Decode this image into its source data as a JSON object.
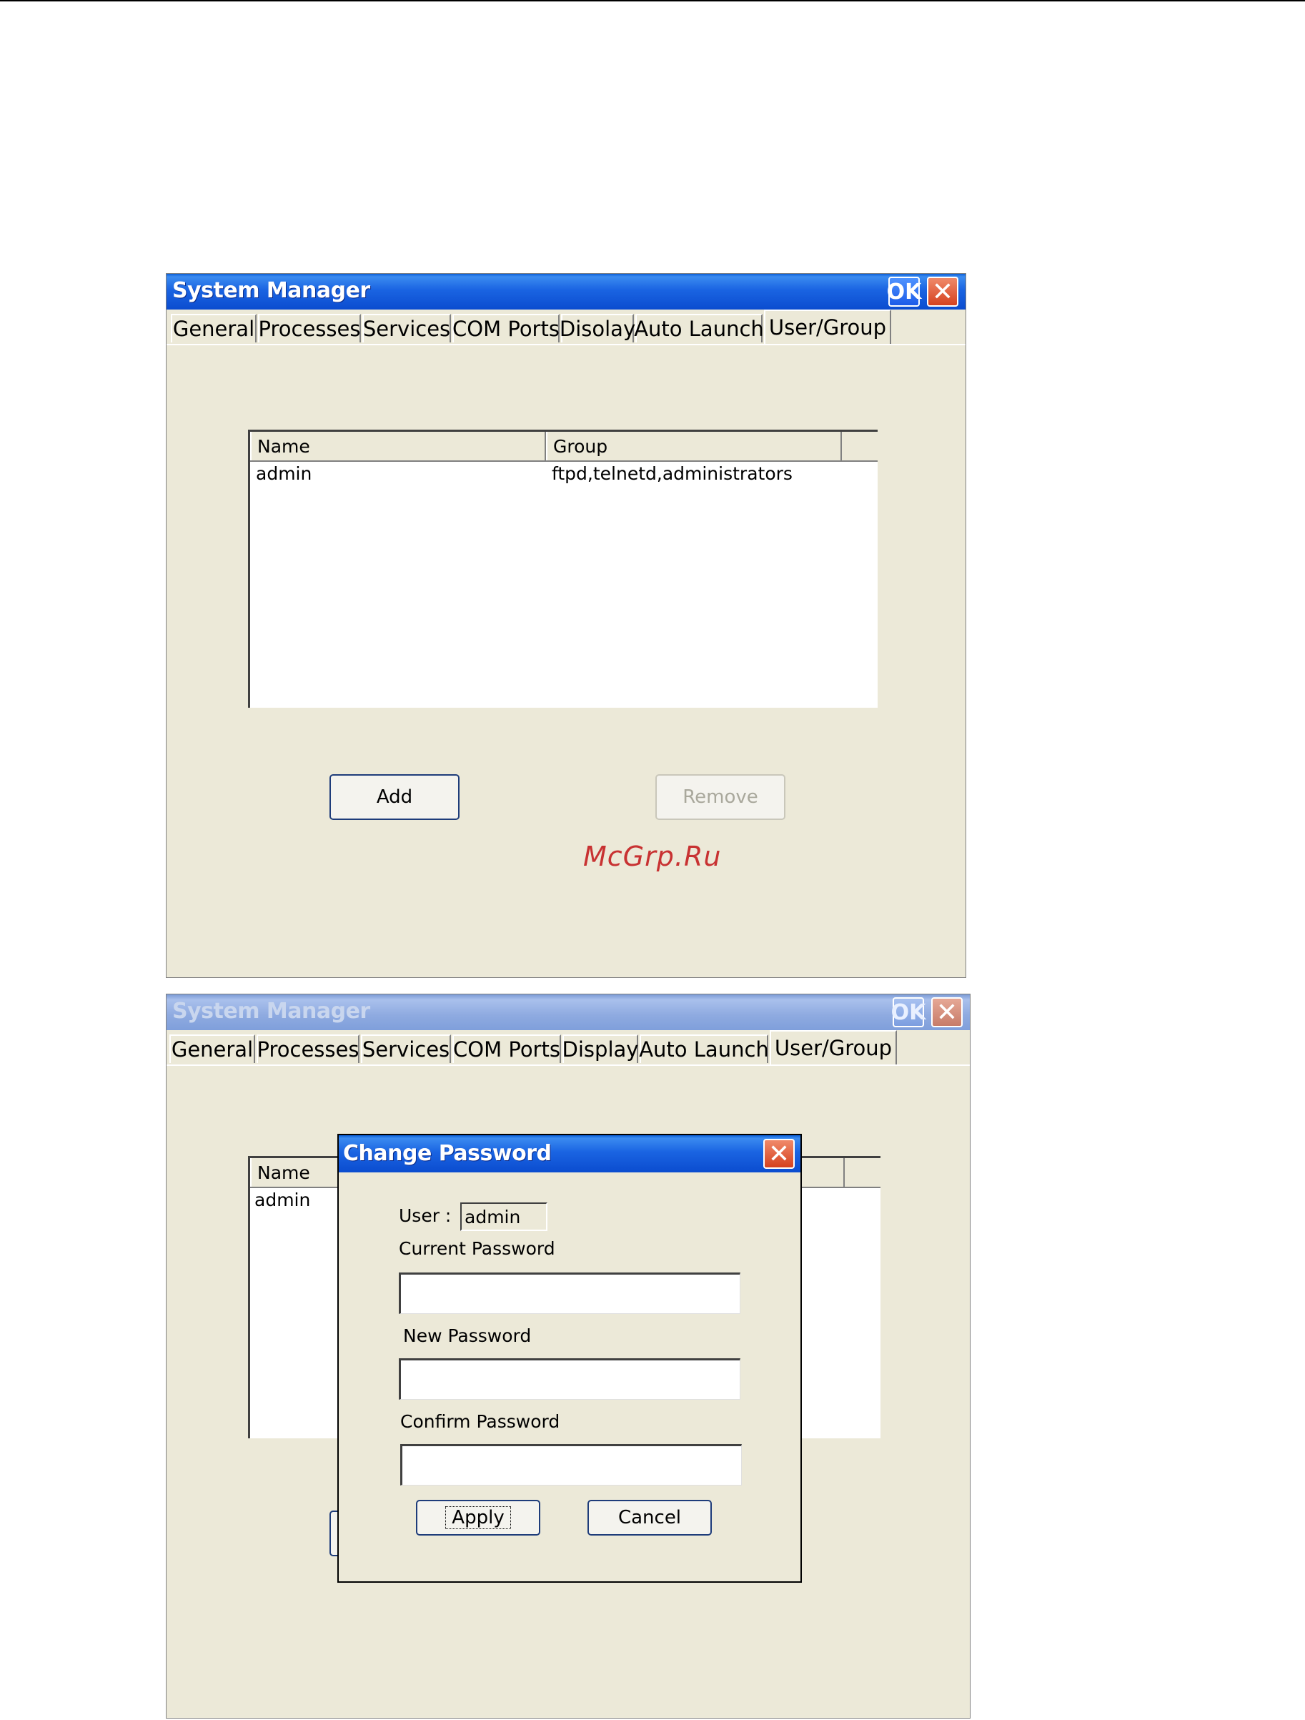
{
  "window1": {
    "title": "System Manager",
    "ok_label": "OK",
    "close_label": "✕",
    "tabs": [
      "General",
      "Processes",
      "Services",
      "COM Ports",
      "Disolay",
      "Auto Launch",
      "User/Group"
    ],
    "active_tab": "User/Group",
    "list": {
      "columns": [
        "Name",
        "Group"
      ],
      "rows": [
        {
          "name": "admin",
          "group": "ftpd,telnetd,administrators"
        }
      ]
    },
    "add_button": "Add",
    "remove_button": "Remove"
  },
  "watermark": "McGrp.Ru",
  "window2": {
    "title": "System Manager",
    "ok_label": "OK",
    "close_label": "✕",
    "tabs": [
      "General",
      "Processes",
      "Services",
      "COM Ports",
      "Display",
      "Auto Launch",
      "User/Group"
    ],
    "active_tab": "User/Group",
    "list": {
      "columns": [
        "Name"
      ],
      "rows": [
        {
          "name": "admin"
        }
      ]
    }
  },
  "change_password_dialog": {
    "title": "Change Password",
    "close_label": "✕",
    "user_label": "User :",
    "user_value": "admin",
    "current_password_label": "Current Password",
    "current_password_value": "",
    "new_password_label": "New Password",
    "new_password_value": "",
    "confirm_password_label": "Confirm Password",
    "confirm_password_value": "",
    "apply_button": "Apply",
    "cancel_button": "Cancel"
  },
  "colors": {
    "titlebar_active": "#1a64e2",
    "titlebar_inactive": "#8eaae0",
    "window_bg": "#ece9d8",
    "watermark": "#c83232"
  }
}
